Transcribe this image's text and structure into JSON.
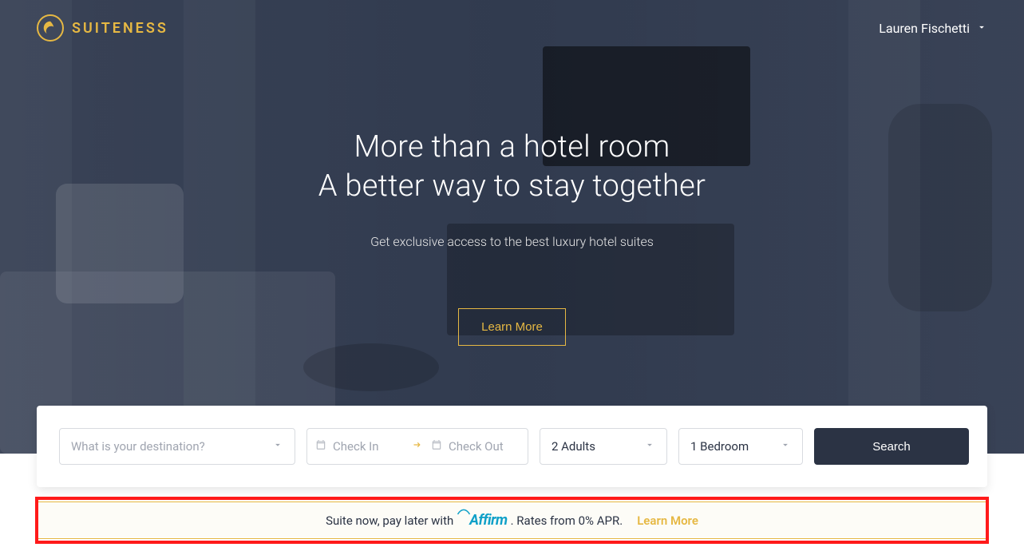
{
  "brand": {
    "name": "SUITENESS"
  },
  "user": {
    "name": "Lauren Fischetti"
  },
  "hero": {
    "headline_line1": "More than a hotel room",
    "headline_line2": "A better way to stay together",
    "subhead": "Get exclusive access to the best luxury hotel suites",
    "learn_more_label": "Learn More"
  },
  "search": {
    "destination_placeholder": "What is your destination?",
    "checkin_placeholder": "Check In",
    "checkout_placeholder": "Check Out",
    "guests_value": "2 Adults",
    "bedrooms_value": "1 Bedroom",
    "search_label": "Search"
  },
  "affirm": {
    "text_before": "Suite now, pay later with ",
    "logo_text": "Affirm",
    "text_after": ". Rates from 0% APR.",
    "learn_more_label": "Learn More"
  }
}
